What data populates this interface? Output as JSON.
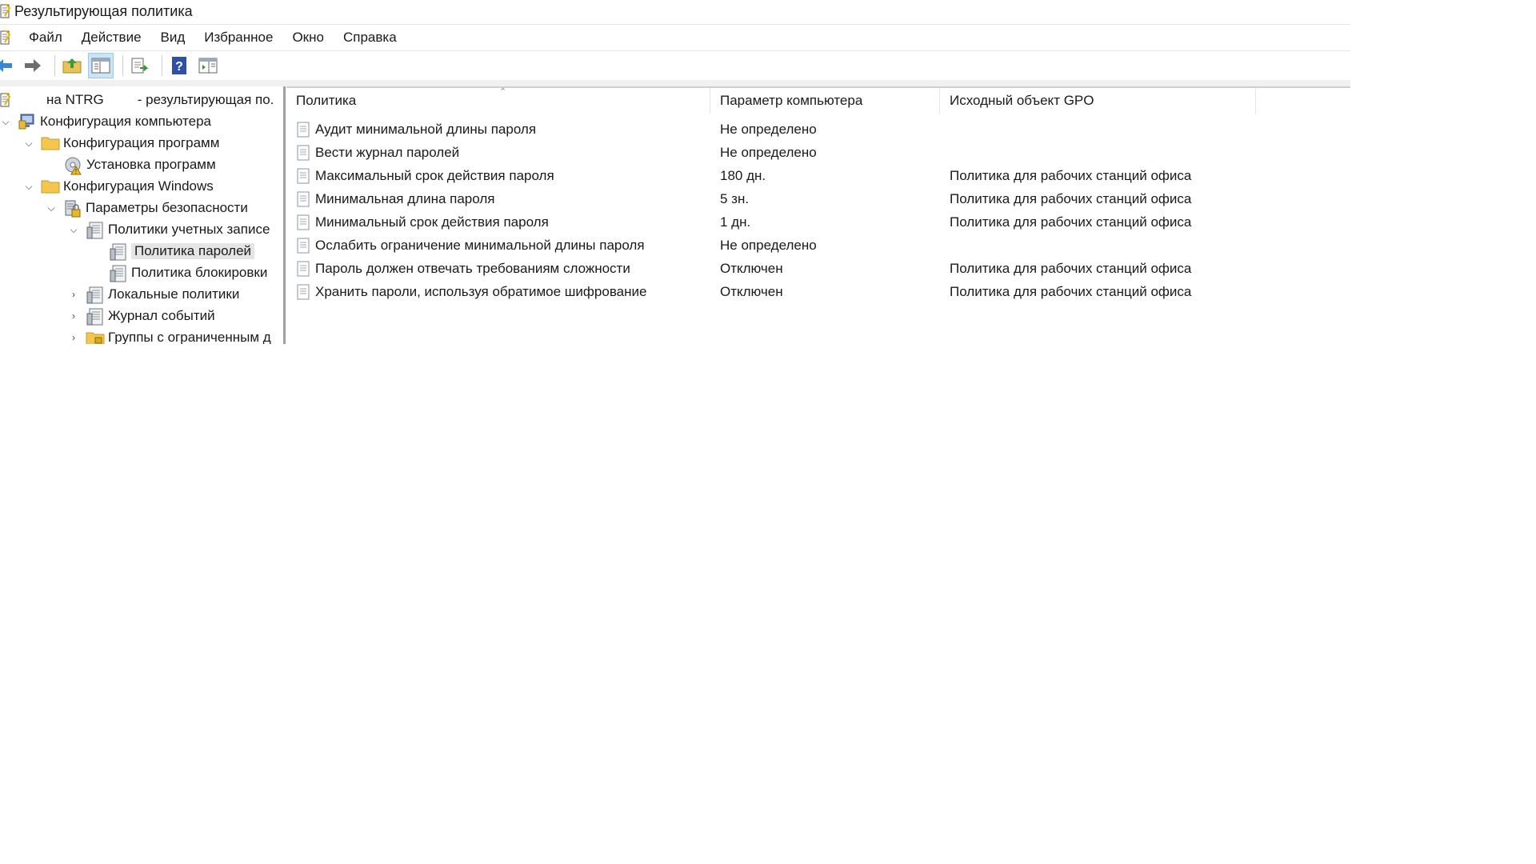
{
  "window": {
    "title": "Результирующая политика"
  },
  "menu": {
    "items": [
      "Файл",
      "Действие",
      "Вид",
      "Избранное",
      "Окно",
      "Справка"
    ]
  },
  "toolbar": {
    "buttons": [
      "back-icon",
      "forward-icon",
      "up-folder-icon",
      "show-hide-tree-icon",
      "export-list-icon",
      "help-icon",
      "show-hide-action-pane-icon"
    ]
  },
  "tree": {
    "root": {
      "prefix": "на NTRG",
      "suffix": "- результирующая по."
    },
    "items": [
      {
        "label": "Конфигурация компьютера",
        "level": 0,
        "expanded": true,
        "icon": "computer-config-icon"
      },
      {
        "label": "Конфигурация программ",
        "level": 1,
        "expanded": true,
        "icon": "folder-icon"
      },
      {
        "label": "Установка программ",
        "level": 2,
        "expanded": null,
        "icon": "software-install-icon"
      },
      {
        "label": "Конфигурация Windows",
        "level": 1,
        "expanded": true,
        "icon": "folder-icon"
      },
      {
        "label": "Параметры безопасности",
        "level": 2,
        "expanded": true,
        "icon": "security-settings-icon"
      },
      {
        "label": "Политики учетных записе",
        "level": 3,
        "expanded": true,
        "icon": "policy-book-icon"
      },
      {
        "label": "Политика паролей",
        "level": 4,
        "expanded": null,
        "icon": "policy-book-icon",
        "selected": true
      },
      {
        "label": "Политика блокировки",
        "level": 4,
        "expanded": null,
        "icon": "policy-book-icon"
      },
      {
        "label": "Локальные политики",
        "level": 3,
        "expanded": false,
        "icon": "policy-book-icon"
      },
      {
        "label": "Журнал событий",
        "level": 3,
        "expanded": false,
        "icon": "policy-book-icon"
      },
      {
        "label": "Группы с ограниченным д",
        "level": 3,
        "expanded": false,
        "icon": "folder-lock-icon"
      }
    ]
  },
  "list": {
    "columns": [
      "Политика",
      "Параметр компьютера",
      "Исходный объект GPO"
    ],
    "rows": [
      {
        "policy": "Аудит минимальной длины пароля",
        "setting": "Не определено",
        "gpo": ""
      },
      {
        "policy": "Вести журнал паролей",
        "setting": "Не определено",
        "gpo": ""
      },
      {
        "policy": "Максимальный срок действия пароля",
        "setting": "180 дн.",
        "gpo": "Политика для рабочих станций офиса"
      },
      {
        "policy": "Минимальная длина пароля",
        "setting": "5 зн.",
        "gpo": "Политика для рабочих станций офиса"
      },
      {
        "policy": "Минимальный срок действия пароля",
        "setting": "1 дн.",
        "gpo": "Политика для рабочих станций офиса"
      },
      {
        "policy": "Ослабить ограничение минимальной длины пароля",
        "setting": "Не определено",
        "gpo": ""
      },
      {
        "policy": "Пароль должен отвечать требованиям сложности",
        "setting": "Отключен",
        "gpo": "Политика для рабочих станций офиса"
      },
      {
        "policy": "Хранить пароли, используя обратимое шифрование",
        "setting": "Отключен",
        "gpo": "Политика для рабочих станций офиса"
      }
    ]
  },
  "colors": {
    "selection": "#e5e5e5",
    "toolbar_active": "#cce4f7",
    "folder": "#f4c650",
    "divider": "#a0a0a0"
  }
}
